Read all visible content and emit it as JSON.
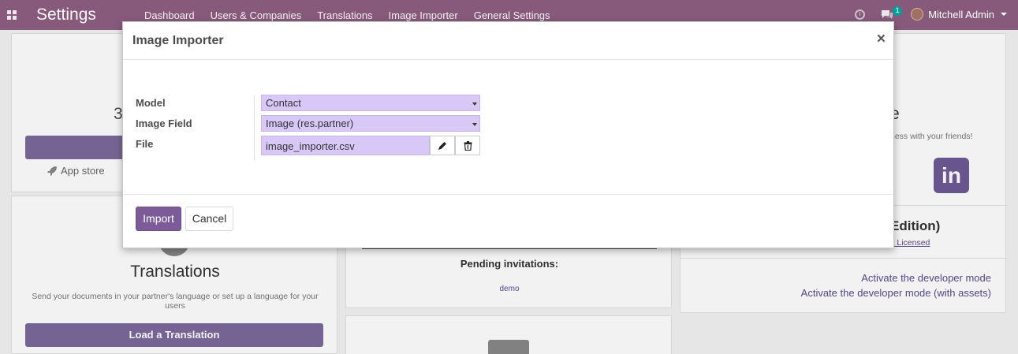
{
  "navbar": {
    "brand": "Settings",
    "menu": [
      "Dashboard",
      "Users & Companies",
      "Translations",
      "Image Importer",
      "General Settings"
    ],
    "chat_badge": "1",
    "user_name": "Mitchell Admin"
  },
  "background": {
    "apps_fragment": "3",
    "app_store": "App store",
    "translations_title": "Translations",
    "translations_desc": "Send your documents in your partner's language or set up a language for your users",
    "load_translation_button": "Load a Translation",
    "pending_invitations": "Pending invitations:",
    "pending_user": "demo",
    "share_fragment": "e",
    "share_desc_fragment": "ness with your friends!",
    "edition_fragment": "Edition)",
    "license_fragment": "L Licensed",
    "dev_mode": "Activate the developer mode",
    "dev_mode_assets": "Activate the developer mode (with assets)"
  },
  "modal": {
    "title": "Image Importer",
    "close": "×",
    "fields": {
      "model_label": "Model",
      "model_value": "Contact",
      "image_field_label": "Image Field",
      "image_field_value": "Image (res.partner)",
      "file_label": "File",
      "file_value": "image_importer.csv"
    },
    "import_button": "Import",
    "cancel_button": "Cancel"
  },
  "colors": {
    "navbar": "#875a7b",
    "primary_button": "#7c5c98",
    "field_bg": "#d8c8f8",
    "link": "#5a4a8c"
  }
}
